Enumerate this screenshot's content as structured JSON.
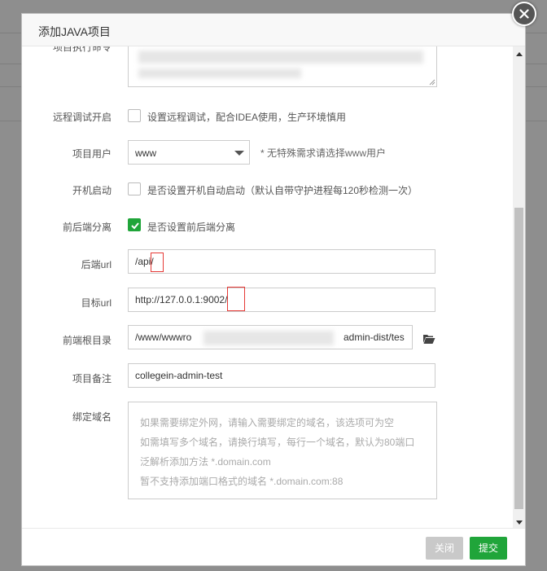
{
  "dialog": {
    "title": "添加JAVA项目",
    "close_icon": "close-icon"
  },
  "form": {
    "description_partial": "项目执行命令",
    "remote_debug": {
      "label": "远程调试开启",
      "checkbox_text": "设置远程调试，配合IDEA使用，生产环境慎用",
      "checked": false
    },
    "project_user": {
      "label": "项目用户",
      "value": "www",
      "hint": "* 无特殊需求请选择www用户"
    },
    "autostart": {
      "label": "开机启动",
      "checkbox_text": "是否设置开机自动启动（默认自带守护进程每120秒检测一次）",
      "checked": false
    },
    "separation": {
      "label": "前后端分离",
      "checkbox_text": "是否设置前后端分离",
      "checked": true
    },
    "backend_url": {
      "label": "后端url",
      "value": "/api/"
    },
    "target_url": {
      "label": "目标url",
      "value": "http://127.0.0.1:9002/"
    },
    "frontend_root": {
      "label": "前端根目录",
      "value_start": "/www/wwwro",
      "value_end": "admin-dist/tes",
      "folder_icon": "folder-open-icon"
    },
    "remark": {
      "label": "项目备注",
      "value": "collegein-admin-test"
    },
    "domain": {
      "label": "绑定域名",
      "placeholder_lines": [
        "如果需要绑定外网，请输入需要绑定的域名，该选项可为空",
        "如需填写多个域名，请换行填写，每行一个域名，默认为80端口",
        "泛解析添加方法 *.domain.com",
        "暂不支持添加端口格式的域名 *.domain.com:88"
      ]
    }
  },
  "footer": {
    "close_label": "关闭",
    "submit_label": "提交"
  },
  "colors": {
    "accent": "#20a53a",
    "highlight": "#e53935"
  }
}
